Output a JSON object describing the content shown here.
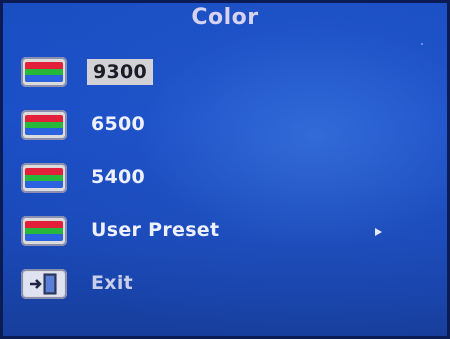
{
  "menu": {
    "title": "Color",
    "items": [
      {
        "label": "9300",
        "icon": "rgb-bars-icon",
        "selected": true
      },
      {
        "label": "6500",
        "icon": "rgb-bars-icon",
        "selected": false
      },
      {
        "label": "5400",
        "icon": "rgb-bars-icon",
        "selected": false
      },
      {
        "label": "User Preset",
        "icon": "rgb-bars-icon",
        "selected": false,
        "has_submenu": true
      },
      {
        "label": "Exit",
        "icon": "exit-door-icon",
        "selected": false
      }
    ]
  },
  "colors": {
    "background": "#1b4fc8",
    "text": "#eef0ff",
    "selected_bg": "#d2d2d6",
    "selected_text": "#1c1c28",
    "icon_red": "#e3203a",
    "icon_green": "#27b83b",
    "icon_blue": "#2b62e0"
  }
}
